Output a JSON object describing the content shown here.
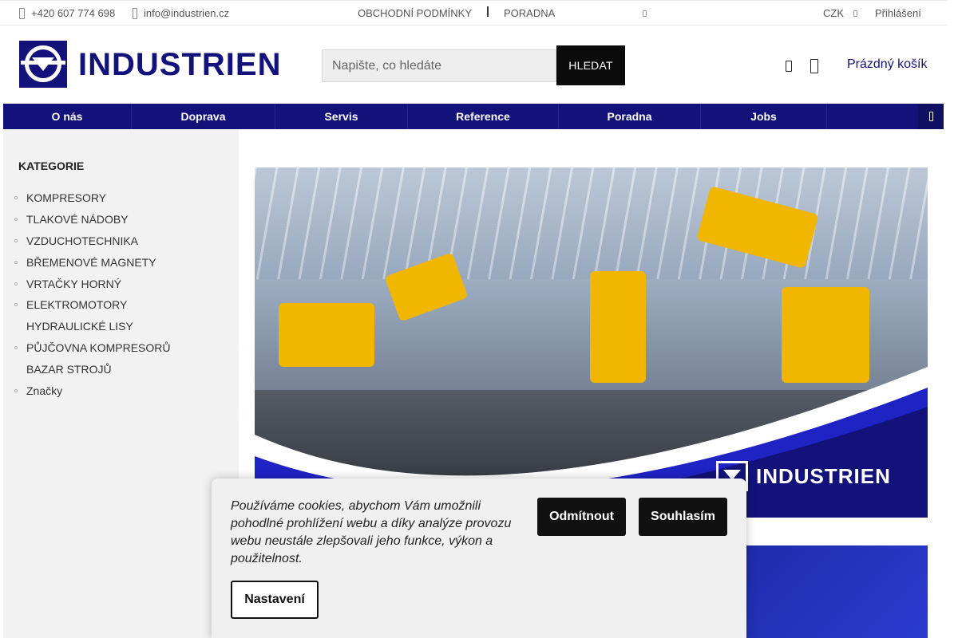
{
  "topbar": {
    "phone": "+420 607 774 698",
    "email": "info@industrien.cz",
    "links": [
      "OBCHODNÍ PODMÍNKY",
      "PORADNA"
    ],
    "currency": "CZK",
    "login": "Přihlášení"
  },
  "header": {
    "logo_text": "INDUSTRIEN",
    "search_placeholder": "Napište, co hledáte",
    "search_button": "HLEDAT",
    "cart_label": "Prázdný košík"
  },
  "nav": {
    "items": [
      "O nás",
      "Doprava",
      "Servis",
      "Reference",
      "Poradna",
      "Jobs"
    ]
  },
  "sidebar": {
    "title": "KATEGORIE",
    "items": [
      {
        "label": "KOMPRESORY",
        "has_children": true
      },
      {
        "label": "TLAKOVÉ NÁDOBY",
        "has_children": true
      },
      {
        "label": "VZDUCHOTECHNIKA",
        "has_children": true
      },
      {
        "label": "BŘEMENOVÉ MAGNETY",
        "has_children": true
      },
      {
        "label": "VRTAČKY HORNÝ",
        "has_children": true
      },
      {
        "label": "ELEKTROMOTORY",
        "has_children": true
      },
      {
        "label": "HYDRAULICKÉ LISY",
        "has_children": false
      },
      {
        "label": "PŮJČOVNA KOMPRESORŮ",
        "has_children": true
      },
      {
        "label": "BAZAR STROJŮ",
        "has_children": false
      },
      {
        "label": "Značky",
        "has_children": true
      }
    ]
  },
  "banner": {
    "logo_text": "INDUSTRIEN"
  },
  "cookie": {
    "text": "Používáme cookies, abychom Vám umožnili pohodlné prohlížení webu a díky analýze provozu webu neustále zlepšovali jeho funkce, výkon a použitelnost.",
    "reject": "Odmítnout",
    "accept": "Souhlasím",
    "settings": "Nastavení"
  },
  "colors": {
    "brand": "#13127a",
    "button_dark": "#111111",
    "sidebar_bg": "#f2f2f2"
  }
}
